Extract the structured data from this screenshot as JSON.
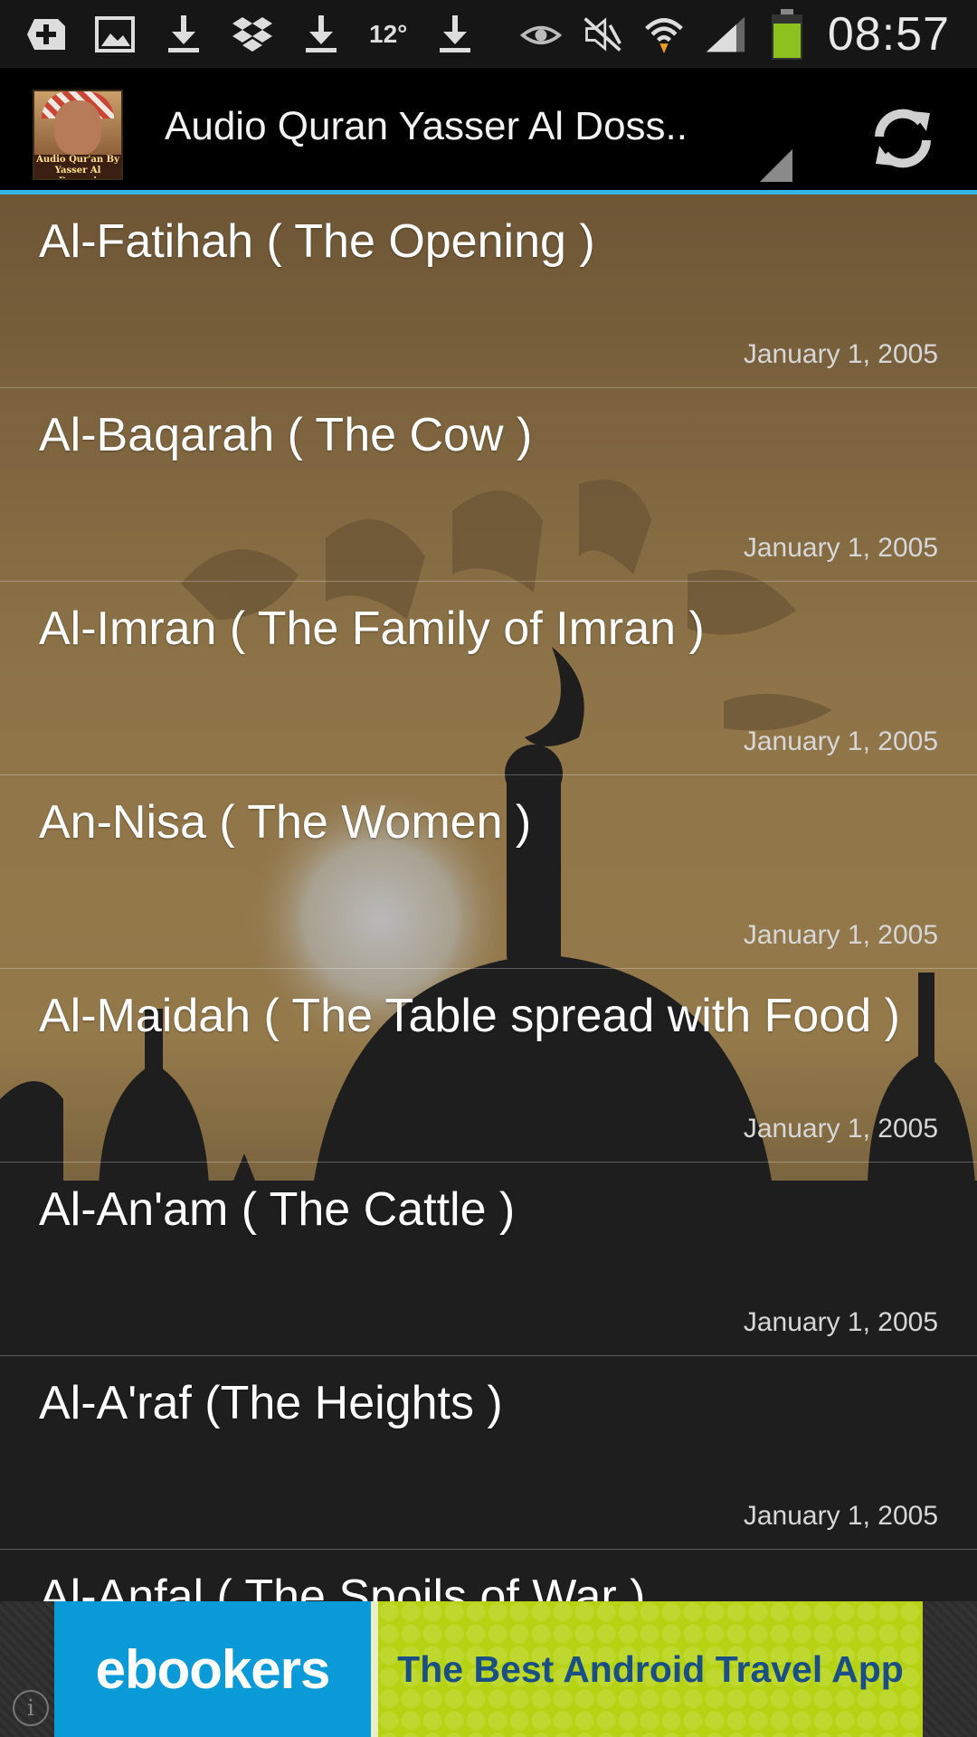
{
  "status_bar": {
    "time": "08:57",
    "temperature": "12°",
    "left_icons": [
      "add-icon",
      "image-icon",
      "download-icon",
      "dropbox-icon",
      "download-icon",
      "download-icon"
    ],
    "right_icons": [
      "eye-icon",
      "mute-icon",
      "wifi-icon",
      "signal-icon",
      "battery-icon"
    ]
  },
  "action_bar": {
    "title": "Audio Quran Yasser Al Doss..",
    "icon_caption": "Audio Qur'an By Yasser Al Dossari",
    "accent_color": "#33b5e5"
  },
  "list": {
    "items": [
      {
        "title": "Al-Fatihah ( The Opening )",
        "date": "January 1, 2005"
      },
      {
        "title": "Al-Baqarah ( The Cow )",
        "date": "January 1, 2005"
      },
      {
        "title": "Al-Imran ( The Family of Imran )",
        "date": "January 1, 2005"
      },
      {
        "title": "An-Nisa ( The Women )",
        "date": "January 1, 2005"
      },
      {
        "title": "Al-Maidah ( The Table spread with Food )",
        "date": "January 1, 2005"
      },
      {
        "title": "Al-An'am ( The Cattle )",
        "date": "January 1, 2005"
      },
      {
        "title": "Al-A'raf (The Heights )",
        "date": "January 1, 2005"
      },
      {
        "title": "Al-Anfal ( The Spoils of War )",
        "date": ""
      }
    ]
  },
  "ad": {
    "brand": "ebookers",
    "tagline": "The Best Android Travel App",
    "info_symbol": "i"
  }
}
